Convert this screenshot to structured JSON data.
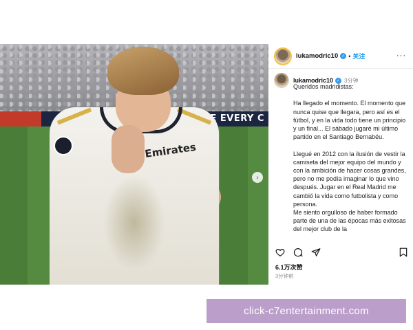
{
  "post": {
    "board_text": "USE EVERY C",
    "sponsor_text": "Fly Emirates",
    "carousel_next_glyph": "›"
  },
  "header": {
    "username": "lukamodric10",
    "verified_glyph": "✓",
    "separator": "•",
    "follow_label": "关注",
    "more_glyph": "···"
  },
  "caption": {
    "username": "lukamodric10",
    "verified_glyph": "✓",
    "time": "3分钟",
    "text": "Queridos madridistas:\n\nHa llegado el momento. El momento que nunca quise que llegara, pero así es el fútbol, y en la vida todo tiene un principio y un final... El sábado jugaré mi último partido en el Santiago Bernabéu.\n\nLlegué en 2012 con la ilusión de vestir la camiseta del mejor equipo del mundo y con la ambición de hacer cosas grandes, pero no me podía imaginar lo que vino después. Jugar en el Real Madrid me cambió la vida como futbolista y como persona.\nMe siento orgulloso de haber formado parte de una de las épocas más exitosas del mejor club de la"
  },
  "actions": {
    "like_icon": "heart-icon",
    "comment_icon": "comment-icon",
    "share_icon": "share-icon",
    "save_icon": "bookmark-icon"
  },
  "stats": {
    "likes": "6.1万次赞",
    "time_ago": "3分钟前"
  },
  "watermark": {
    "text": "click-c7entertainment.com"
  }
}
